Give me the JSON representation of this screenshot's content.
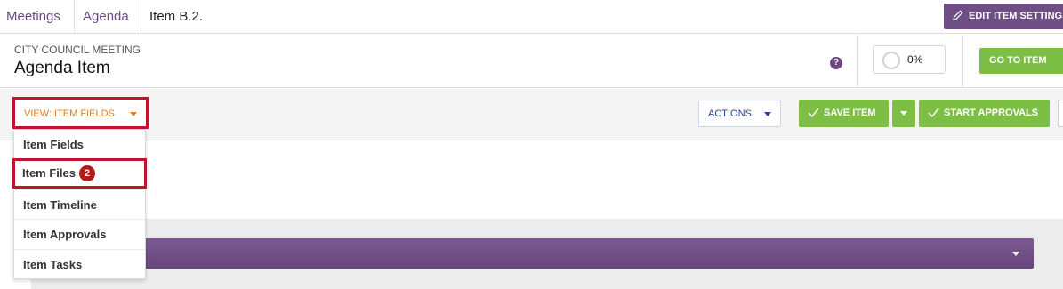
{
  "breadcrumb": {
    "meetings": "Meetings",
    "agenda": "Agenda",
    "current": "Item B.2."
  },
  "edit_settings_label": "EDIT ITEM SETTINGS",
  "header": {
    "subtitle": "CITY COUNCIL MEETING",
    "title": "Agenda Item",
    "help": "?"
  },
  "progress": {
    "value": 0,
    "text": "0%"
  },
  "goto_label": "GO TO ITEM",
  "toolbar": {
    "view_label": "VIEW: ITEM FIELDS",
    "actions_label": "ACTIONS",
    "save_label": "SAVE ITEM",
    "approvals_label": "START APPROVALS"
  },
  "view_menu": {
    "items": [
      {
        "label": "Item Fields"
      },
      {
        "label": "Item Files",
        "badge": "2"
      },
      {
        "label": "Item Timeline"
      },
      {
        "label": "Item Approvals"
      },
      {
        "label": "Item Tasks"
      }
    ]
  },
  "colors": {
    "purple": "#6e4e85",
    "green": "#7dbf45",
    "orange": "#e07d1e",
    "highlight_red": "#c0142c",
    "badge_red": "#b51a1a",
    "actions_blue": "#2a3f9a"
  },
  "icons": {
    "edit": "pencil-icon",
    "help": "help-icon",
    "check": "check-icon",
    "caret": "caret-down-icon"
  }
}
